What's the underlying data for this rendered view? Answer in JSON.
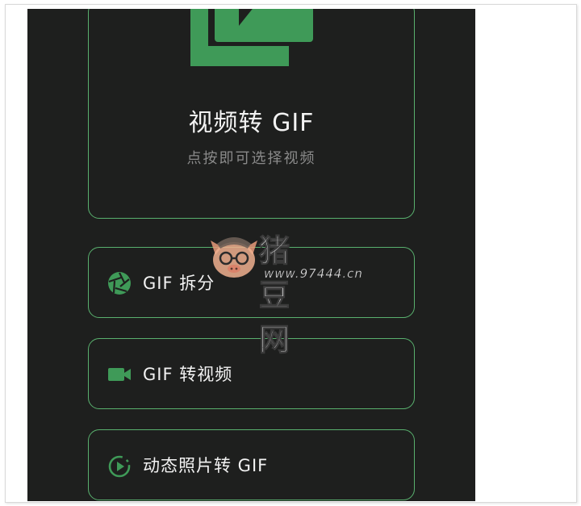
{
  "hero": {
    "title": "视频转 GIF",
    "subtitle": "点按即可选择视频",
    "icon": "video-file-icon"
  },
  "menu": [
    {
      "label": "GIF 拆分",
      "icon": "aperture-icon"
    },
    {
      "label": "GIF 转视频",
      "icon": "videocam-icon"
    },
    {
      "label": "动态照片转 GIF",
      "icon": "motion-photo-icon"
    }
  ],
  "watermark": {
    "site_name": "猪豆网",
    "url": "www.97444.cn"
  },
  "colors": {
    "background": "#1e1f1e",
    "accent": "#59b06e",
    "icon_green": "#3f9a58",
    "text": "#f2f2f2",
    "muted": "#8a8a8a"
  }
}
